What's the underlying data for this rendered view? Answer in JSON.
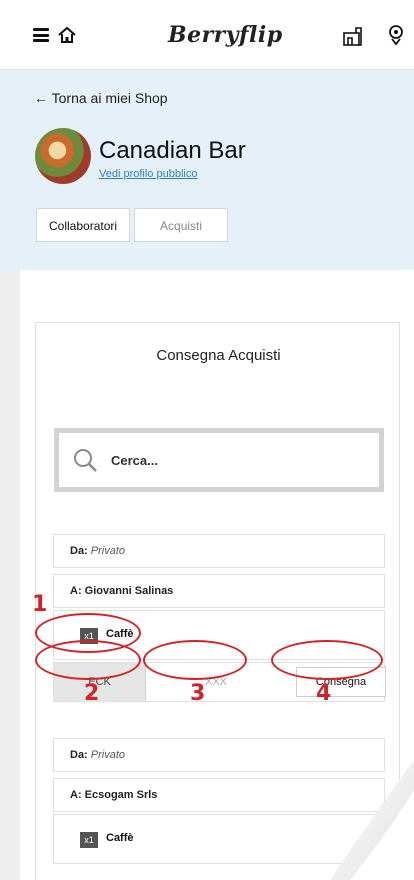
{
  "topbar": {
    "logo": "Berryflip",
    "icons": [
      "menu-icon",
      "home-icon",
      "shop-icon",
      "location-pin-icon"
    ]
  },
  "header": {
    "back_link": "← Torna ai miei Shop",
    "shop_name": "Canadian Bar",
    "profile_link": "Vedi profilo pubblico",
    "tabs": [
      {
        "label": "Collaboratori",
        "active": true
      },
      {
        "label": "Acquisti",
        "active": false
      }
    ]
  },
  "card": {
    "title": "Consegna Acquisti",
    "search_placeholder": "Cerca...",
    "orders": [
      {
        "from_label": "Da:",
        "from_value": "Privato",
        "to_text": "A: Giovanni Salinas",
        "qty": "x1",
        "product": "Caffè",
        "eck_label": "ECK",
        "code_placeholder": "XXX",
        "deliver_label": "Consegna"
      },
      {
        "from_label": "Da:",
        "from_value": "Privato",
        "to_text": "A: Ecsogam Srls",
        "qty": "x1",
        "product": "Caffè"
      }
    ]
  },
  "annotations": [
    "1",
    "2",
    "3",
    "4"
  ],
  "colors": {
    "header_bg": "#e6f0f8",
    "annotation_red": "#d2232a",
    "link": "#2f7fc7"
  }
}
